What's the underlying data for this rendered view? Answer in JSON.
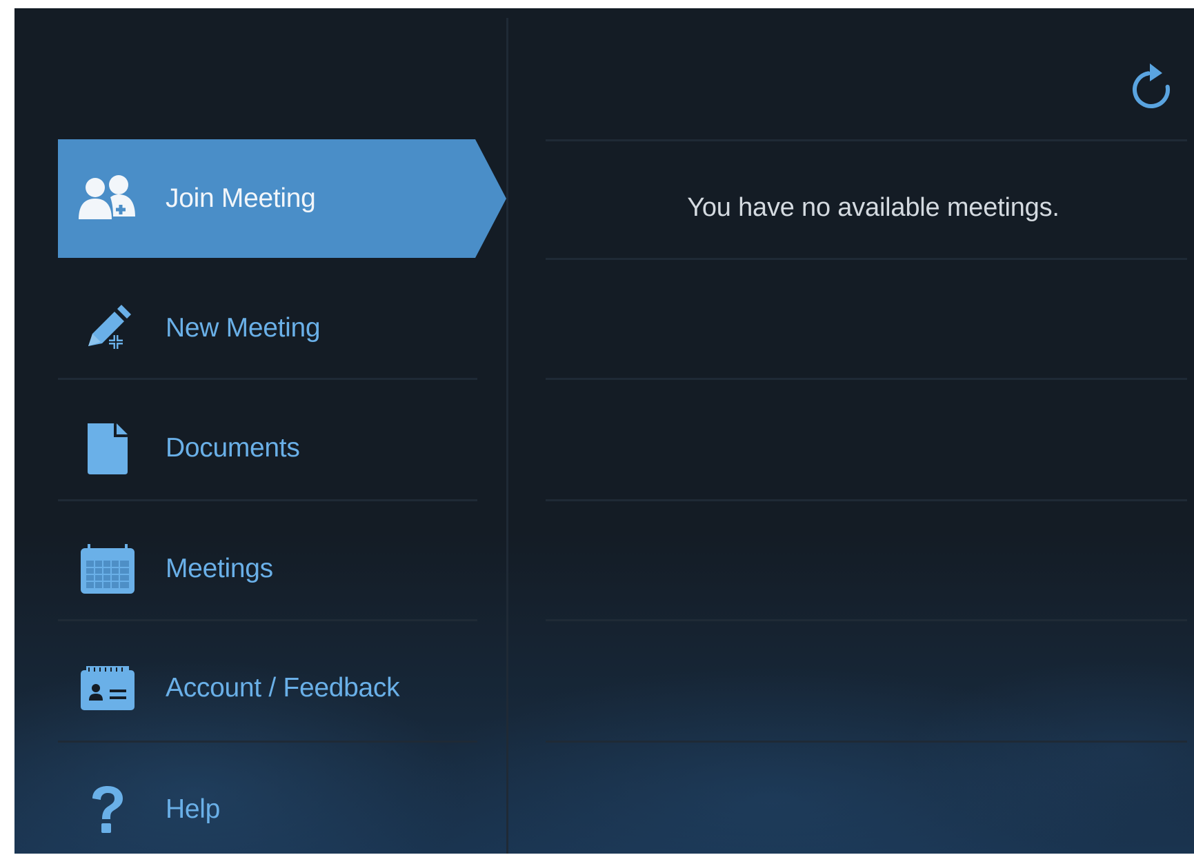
{
  "sidebar": {
    "items": [
      {
        "label": "Join Meeting",
        "icon": "people-icon",
        "active": true
      },
      {
        "label": "New Meeting",
        "icon": "pencil-plus-icon",
        "active": false
      },
      {
        "label": "Documents",
        "icon": "document-icon",
        "active": false
      },
      {
        "label": "Meetings",
        "icon": "calendar-icon",
        "active": false
      },
      {
        "label": "Account / Feedback",
        "icon": "id-card-icon",
        "active": false
      },
      {
        "label": "Help",
        "icon": "question-icon",
        "active": false
      }
    ]
  },
  "main": {
    "refresh_icon": "refresh-icon",
    "empty_message": "You have no available meetings."
  },
  "colors": {
    "background": "#141c25",
    "active_item": "#4a8ec8",
    "accent": "#6ab0e8",
    "divider": "#1f2a36"
  }
}
